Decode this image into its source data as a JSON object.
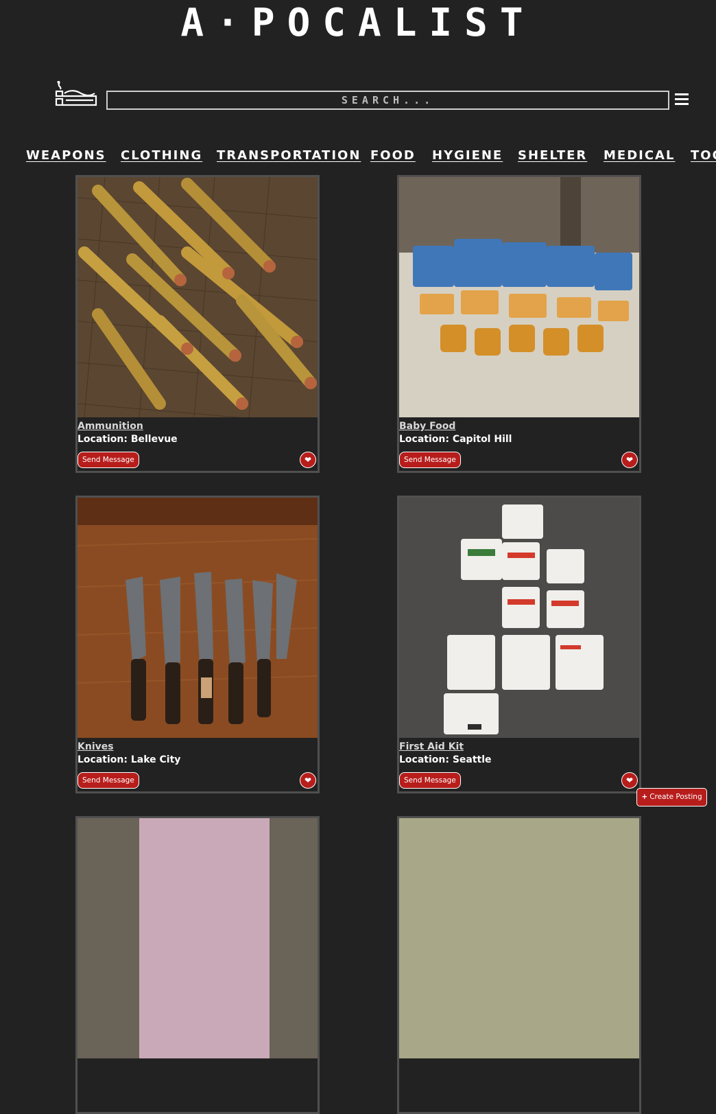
{
  "site": {
    "logo": "A·POCALIST"
  },
  "search": {
    "placeholder": "SEARCH..."
  },
  "nav": [
    "WEAPONS",
    "CLOTHING",
    "TRANSPORTATION",
    "FOOD",
    "HYGIENE",
    "SHELTER",
    "MEDICAL",
    "TOOLS"
  ],
  "listings": [
    {
      "title": "Ammunition",
      "location": "Location: Bellevue",
      "button": "Send Message"
    },
    {
      "title": "Baby Food",
      "location": "Location: Capitol Hill",
      "button": "Send Message"
    },
    {
      "title": "Knives",
      "location": "Location: Lake City",
      "button": "Send Message"
    },
    {
      "title": "First Aid Kit",
      "location": "Location: Seattle",
      "button": "Send Message"
    }
  ],
  "create_posting": "Create Posting",
  "colors": {
    "background": "#222222",
    "accent": "#b71d1b",
    "card_border": "#505050"
  },
  "icons": [
    "brand-icon",
    "menu-icon",
    "heart-icon",
    "plus-icon"
  ]
}
